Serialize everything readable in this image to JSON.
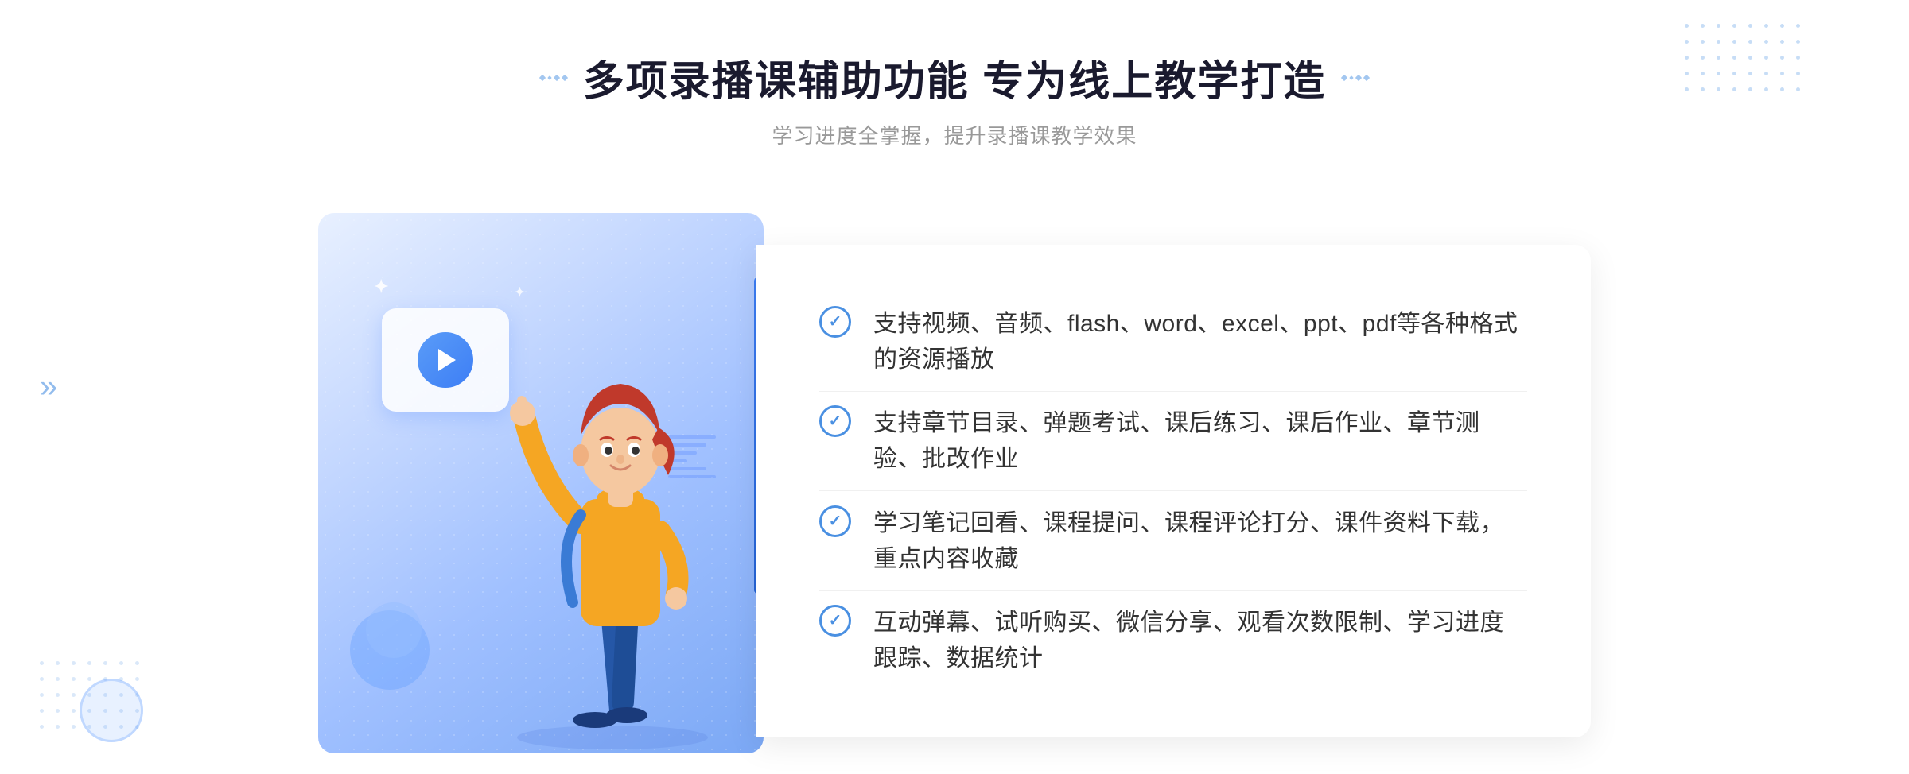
{
  "header": {
    "title": "多项录播课辅助功能 专为线上教学打造",
    "subtitle": "学习进度全掌握，提升录播课教学效果"
  },
  "features": [
    {
      "id": 1,
      "text": "支持视频、音频、flash、word、excel、ppt、pdf等各种格式的资源播放"
    },
    {
      "id": 2,
      "text": "支持章节目录、弹题考试、课后练习、课后作业、章节测验、批改作业"
    },
    {
      "id": 3,
      "text": "学习笔记回看、课程提问、课程评论打分、课件资料下载，重点内容收藏"
    },
    {
      "id": 4,
      "text": "互动弹幕、试听购买、微信分享、观看次数限制、学习进度跟踪、数据统计"
    }
  ],
  "colors": {
    "primary": "#4a90e2",
    "title_color": "#1a1a2e",
    "text_color": "#333333",
    "subtitle_color": "#999999"
  }
}
